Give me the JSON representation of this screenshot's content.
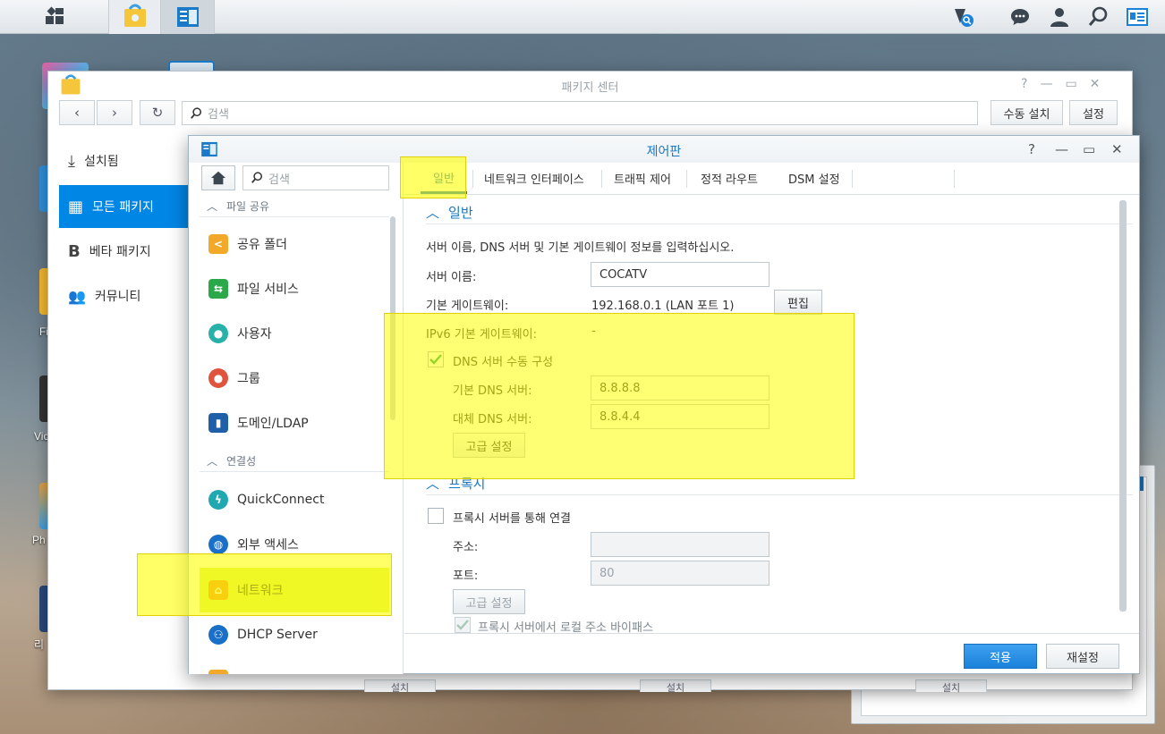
{
  "taskbar": {
    "icons": [
      "main-menu-icon",
      "package-center-icon",
      "control-panel-icon",
      "search-notify-icon",
      "chat-icon",
      "user-icon",
      "search-icon",
      "widgets-icon"
    ]
  },
  "desktop": {
    "labels": [
      "Fi",
      "Vic",
      "Ph",
      "리"
    ]
  },
  "package_center": {
    "title": "패키지 센터",
    "search_placeholder": "검색",
    "manual_install": "수동 설치",
    "settings": "설정",
    "sidebar": [
      {
        "label": "설치됨",
        "icon": "download-icon"
      },
      {
        "label": "모든 패키지",
        "icon": "grid-icon"
      },
      {
        "label": "베타 패키지",
        "icon": "beta-icon"
      },
      {
        "label": "커뮤니티",
        "icon": "community-icon"
      }
    ],
    "bottom_buttons": [
      "설치",
      "설치",
      "설치"
    ]
  },
  "control_panel": {
    "title": "제어판",
    "search_placeholder": "검색",
    "sidebar": {
      "cat_file_sharing": "파일 공유",
      "shared_folder": "공유 폴더",
      "file_services": "파일 서비스",
      "user": "사용자",
      "group": "그룹",
      "domain_ldap": "도메인/LDAP",
      "cat_connectivity": "연결성",
      "quickconnect": "QuickConnect",
      "external_access": "외부 액세스",
      "network": "네트워크",
      "dhcp_server": "DHCP Server"
    },
    "tabs": [
      "일반",
      "네트워크 인터페이스",
      "트래픽 제어",
      "정적 라우트",
      "DSM 설정"
    ],
    "general": {
      "section_title": "일반",
      "description": "서버 이름, DNS 서버 및 기본 게이트웨이 정보를 입력하십시오.",
      "server_name_label": "서버 이름:",
      "server_name_value": "COCATV",
      "gateway_label": "기본 게이트웨이:",
      "gateway_value": "192.168.0.1 (LAN 포트 1)",
      "edit_button": "편집",
      "ipv6_gateway_label": "IPv6 기본 게이트웨이:",
      "ipv6_gateway_value": "-",
      "dns_manual_label": "DNS 서버 수동 구성",
      "dns_manual_checked": true,
      "primary_dns_label": "기본 DNS 서버:",
      "primary_dns_value": "8.8.8.8",
      "secondary_dns_label": "대체 DNS 서버:",
      "secondary_dns_value": "8.8.4.4",
      "advanced_button": "고급 설정"
    },
    "proxy": {
      "section_title": "프록시",
      "connect_via_proxy_label": "프록시 서버를 통해 연결",
      "connect_via_proxy_checked": false,
      "address_label": "주소:",
      "address_value": "",
      "port_label": "포트:",
      "port_value": "80",
      "advanced_button": "고급 설정",
      "bypass_label": "프록시 서버에서 로컬 주소 바이패스",
      "bypass_checked": true
    },
    "footer": {
      "apply": "적용",
      "reset": "재설정"
    }
  },
  "colors": {
    "accent": "#0086e5",
    "selected_item": "#d7eb5a",
    "highlight": "#ffff00"
  }
}
